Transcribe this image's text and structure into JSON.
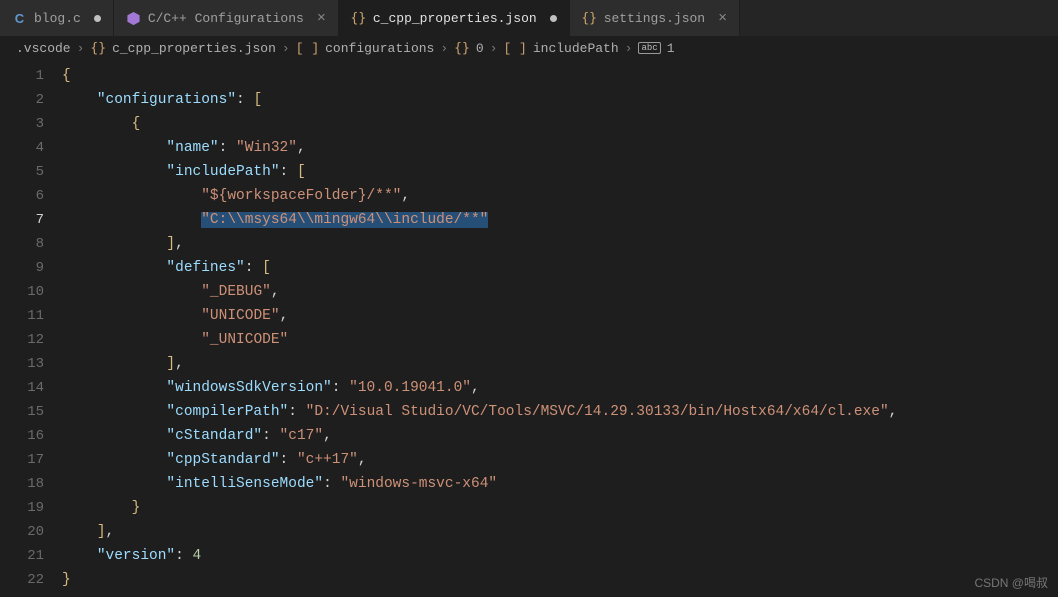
{
  "tabs": [
    {
      "icon": "c-file-icon",
      "label": "blog.c",
      "dirty": true,
      "active": false
    },
    {
      "icon": "cpp-logo-icon",
      "label": "C/C++ Configurations",
      "close": true,
      "active": false
    },
    {
      "icon": "json-brace-icon",
      "label": "c_cpp_properties.json",
      "dirty": true,
      "active": true
    },
    {
      "icon": "json-brace-icon",
      "label": "settings.json",
      "close": true,
      "active": false
    }
  ],
  "breadcrumb": {
    "seg0": ".vscode",
    "seg1": "c_cpp_properties.json",
    "seg2": "configurations",
    "seg3": "0",
    "seg4": "includePath",
    "seg5": "1",
    "sep": "›"
  },
  "lineNumbers": [
    "1",
    "2",
    "3",
    "4",
    "5",
    "6",
    "7",
    "8",
    "9",
    "10",
    "11",
    "12",
    "13",
    "14",
    "15",
    "16",
    "17",
    "18",
    "19",
    "20",
    "21",
    "22"
  ],
  "currentLine": "7",
  "code": {
    "configurations_key": "\"configurations\"",
    "name_key": "\"name\"",
    "name_val": "\"Win32\"",
    "includePath_key": "\"includePath\"",
    "inc0": "\"${workspaceFolder}/**\"",
    "inc1": "\"C:\\\\msys64\\\\mingw64\\\\include/**\"",
    "defines_key": "\"defines\"",
    "def0": "\"_DEBUG\"",
    "def1": "\"UNICODE\"",
    "def2": "\"_UNICODE\"",
    "windowsSdk_key": "\"windowsSdkVersion\"",
    "windowsSdk_val": "\"10.0.19041.0\"",
    "compilerPath_key": "\"compilerPath\"",
    "compilerPath_val": "\"D:/Visual Studio/VC/Tools/MSVC/14.29.30133/bin/Hostx64/x64/cl.exe\"",
    "cStandard_key": "\"cStandard\"",
    "cStandard_val": "\"c17\"",
    "cppStandard_key": "\"cppStandard\"",
    "cppStandard_val": "\"c++17\"",
    "intelliSense_key": "\"intelliSenseMode\"",
    "intelliSense_val": "\"windows-msvc-x64\"",
    "version_key": "\"version\"",
    "version_val": "4"
  },
  "watermark": "CSDN @喝叔"
}
